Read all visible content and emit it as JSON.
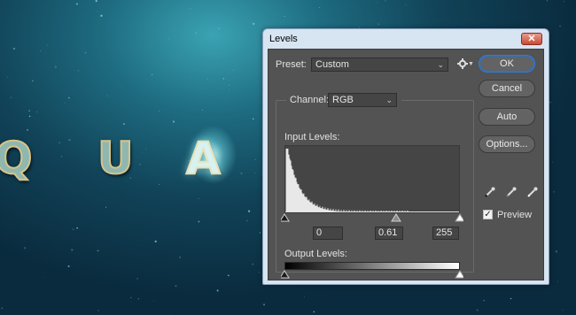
{
  "background": {
    "letters": [
      "Q",
      "U",
      "A"
    ]
  },
  "dialog": {
    "title": "Levels",
    "close_glyph": "✕",
    "preset_label": "Preset:",
    "preset_value": "Custom",
    "channel_label": "Channel:",
    "channel_value": "RGB",
    "input_levels_label": "Input Levels:",
    "input_black": "0",
    "input_gamma": "0.61",
    "input_white": "255",
    "output_levels_label": "Output Levels:",
    "output_black": "0",
    "output_white": "255",
    "buttons": {
      "ok": "OK",
      "cancel": "Cancel",
      "auto": "Auto",
      "options": "Options..."
    },
    "preview_label": "Preview",
    "preview_checked": true,
    "icons": [
      "gear-icon",
      "black-point-eyedropper-icon",
      "gray-point-eyedropper-icon",
      "white-point-eyedropper-icon"
    ],
    "colors": {
      "accent": "#2f7bd6",
      "panel": "#535353",
      "close": "#c94a36"
    }
  }
}
